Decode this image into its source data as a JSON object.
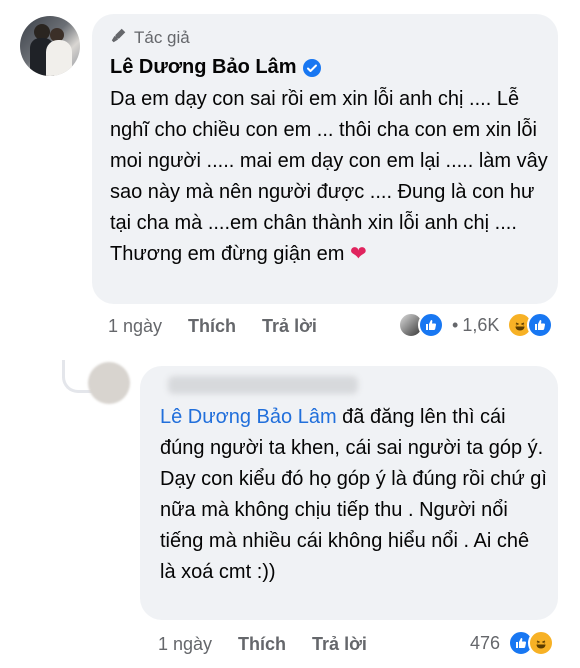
{
  "comment1": {
    "role_label": "Tác giả",
    "author": "Lê Dương Bảo Lâm",
    "text": "Da em dạy con sai rồi em xin lỗi anh chị .... Lễ nghĩ cho chiều con em ... thôi cha con em xin lỗi moi người ..... mai em dạy con em lại ..... làm vây sao này mà nên người được .... Đung là con hư tại cha mà ....em chân thành xin lỗi anh chị .... Thương em đừng giận em",
    "time": "1 ngày",
    "like_label": "Thích",
    "reply_label": "Trả lời",
    "reaction_count": "1,6K"
  },
  "comment2": {
    "mention": "Lê Dương Bảo Lâm",
    "text": " đã đăng lên thì cái đúng người ta khen, cái sai người ta góp ý. Dạy con kiểu đó họ góp ý là đúng rồi chứ gì nữa mà không chịu tiếp thu . Người nổi tiếng mà nhiều cái không hiểu nổi . Ai chê là xoá cmt :))",
    "time": "1 ngày",
    "like_label": "Thích",
    "reply_label": "Trả lời",
    "reaction_count": "476"
  },
  "colors": {
    "bubble": "#f0f2f5",
    "mention": "#216fdb",
    "meta": "#65676b",
    "like": "#1877f2"
  },
  "icons": [
    "microphone-icon",
    "verified-badge-icon",
    "heart-emoji-icon",
    "like-reaction-icon",
    "haha-reaction-icon"
  ]
}
